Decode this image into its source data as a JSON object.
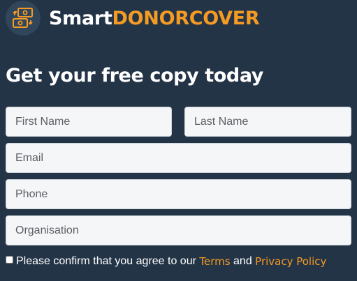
{
  "brand": {
    "name_part1": "Smart",
    "name_part2": "DONORCOVER",
    "logo_icon": "money-exchange-icon"
  },
  "heading": "Get your free copy today",
  "form": {
    "first_name_placeholder": "First Name",
    "last_name_placeholder": "Last Name",
    "email_placeholder": "Email",
    "phone_placeholder": "Phone",
    "organisation_placeholder": "Organisation",
    "consent": {
      "checked": false,
      "text_before": "Please confirm that you agree to our",
      "terms_label": "Terms",
      "conjunction": "and",
      "privacy_label": "Privacy Policy"
    }
  },
  "colors": {
    "background": "#243447",
    "accent": "#f59b23",
    "text": "#ffffff",
    "field_background": "#f4f6f8"
  }
}
